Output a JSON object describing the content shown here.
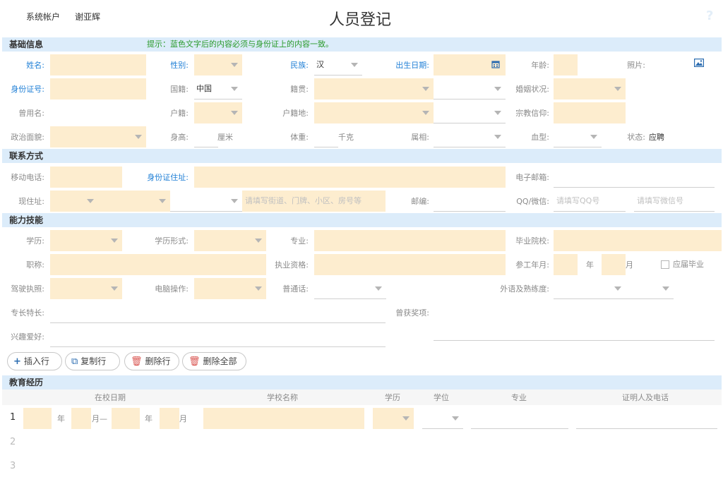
{
  "top": {
    "account_label": "系统帐户",
    "user_name": "谢亚辉",
    "title": "人员登记",
    "help_glyph": "?"
  },
  "sections": {
    "basic": "基础信息",
    "basic_hint": "提示：蓝色文字后的内容必须与身份证上的内容一致。",
    "contact": "联系方式",
    "ability": "能力技能",
    "education": "教育经历"
  },
  "basic": {
    "name_label": "姓名:",
    "gender_label": "性别:",
    "ethnic_label": "民族:",
    "ethnic_value": "汉",
    "birth_label": "出生日期:",
    "age_label": "年龄:",
    "photo_label": "照片:",
    "idcard_label": "身份证号:",
    "nationality_label": "国籍:",
    "nationality_value": "中国",
    "origin_label": "籍贯:",
    "marital_label": "婚姻状况:",
    "former_name_label": "曾用名:",
    "household_label": "户籍:",
    "household_place_label": "户籍地:",
    "religion_label": "宗教信仰:",
    "politics_label": "政治面貌:",
    "height_label": "身高:",
    "height_unit": "厘米",
    "weight_label": "体重:",
    "weight_unit": "千克",
    "zodiac_label": "属相:",
    "blood_label": "血型:",
    "status_label": "状态:",
    "status_value": "应聘"
  },
  "contact": {
    "mobile_label": "移动电话:",
    "id_address_label": "身份证住址:",
    "email_label": "电子邮箱:",
    "current_address_label": "现住址:",
    "street_placeholder": "请填写街道、门牌、小区、房号等",
    "postcode_label": "邮编:",
    "qq_label": "QQ/微信:",
    "qq_placeholder": "请填写QQ号",
    "wechat_placeholder": "请填写微信号"
  },
  "ability": {
    "education_label": "学历:",
    "edu_form_label": "学历形式:",
    "major_label": "专业:",
    "school_label": "毕业院校:",
    "title_label": "职称:",
    "qualification_label": "执业资格:",
    "work_start_label": "参工年月:",
    "year_unit": "年",
    "month_unit": "月",
    "fresh_grad_label": "应届毕业",
    "license_label": "驾驶执照:",
    "computer_label": "电脑操作:",
    "mandarin_label": "普通话:",
    "foreign_lang_label": "外语及熟练度:",
    "specialty_label": "专长特长:",
    "awards_label": "曾获奖项:",
    "hobby_label": "兴趣爱好:"
  },
  "toolbar": {
    "insert_label": "插入行",
    "copy_label": "复制行",
    "delete_label": "删除行",
    "delete_all_label": "删除全部"
  },
  "education_table": {
    "columns": [
      "在校日期",
      "学校名称",
      "学历",
      "学位",
      "专业",
      "证明人及电话"
    ],
    "row_numbers": [
      "1",
      "2",
      "3"
    ],
    "year_unit": "年",
    "month_dash": "月—",
    "month_unit": "月"
  }
}
